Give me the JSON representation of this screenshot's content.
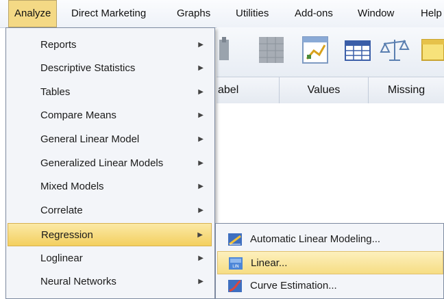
{
  "menubar": {
    "items": [
      {
        "label": "Analyze"
      },
      {
        "label": "Direct Marketing"
      },
      {
        "label": "Graphs"
      },
      {
        "label": "Utilities"
      },
      {
        "label": "Add-ons"
      },
      {
        "label": "Window"
      },
      {
        "label": "Help"
      }
    ],
    "active": "Analyze"
  },
  "grid": {
    "columns": [
      {
        "label": "abel"
      },
      {
        "label": "Values"
      },
      {
        "label": "Missing"
      }
    ]
  },
  "dropdown": {
    "items": [
      {
        "label": "Reports",
        "has_submenu": true
      },
      {
        "label": "Descriptive Statistics",
        "has_submenu": true
      },
      {
        "label": "Tables",
        "has_submenu": true
      },
      {
        "label": "Compare Means",
        "has_submenu": true
      },
      {
        "label": "General Linear Model",
        "has_submenu": true
      },
      {
        "label": "Generalized Linear Models",
        "has_submenu": true
      },
      {
        "label": "Mixed Models",
        "has_submenu": true
      },
      {
        "label": "Correlate",
        "has_submenu": true
      },
      {
        "label": "Regression",
        "has_submenu": true,
        "active": true
      },
      {
        "label": "Loglinear",
        "has_submenu": true
      },
      {
        "label": "Neural Networks",
        "has_submenu": true
      }
    ],
    "arrow_glyph": "▶"
  },
  "submenu": {
    "items": [
      {
        "label": "Automatic Linear Modeling...",
        "icon": "automatic-linear-modeling-icon"
      },
      {
        "label": "Linear...",
        "icon": "linear-regression-icon",
        "active": true
      },
      {
        "label": "Curve Estimation...",
        "icon": "curve-estimation-icon"
      }
    ]
  },
  "colors": {
    "highlight": "#f3cf5f",
    "menu_background": "#f3f5f9",
    "menubar_active": "#f4d985"
  }
}
